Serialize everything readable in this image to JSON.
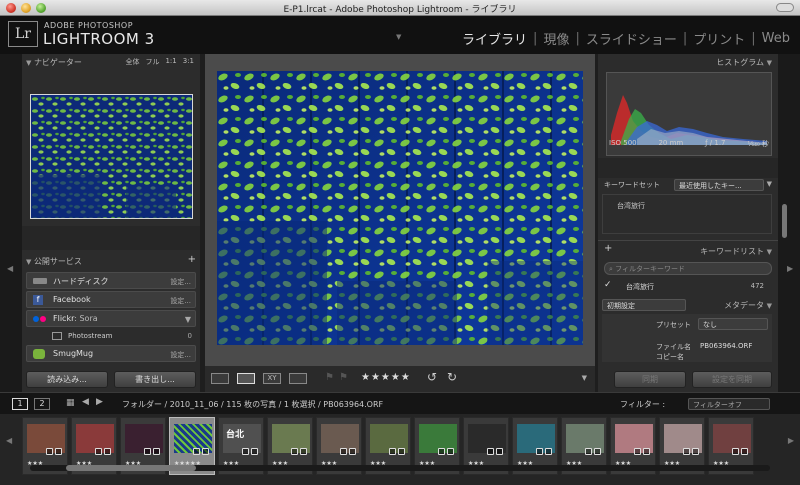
{
  "window": {
    "title": "E-P1.lrcat - Adobe Photoshop Lightroom - ライブラリ"
  },
  "brand": {
    "small": "ADOBE PHOTOSHOP",
    "big": "LIGHTROOM 3",
    "logo": "Lr"
  },
  "modules": [
    {
      "label": "ライブラリ",
      "active": true
    },
    {
      "label": "現像",
      "active": false
    },
    {
      "label": "スライドショー",
      "active": false
    },
    {
      "label": "プリント",
      "active": false
    },
    {
      "label": "Web",
      "active": false
    }
  ],
  "left": {
    "navigator": {
      "title": "ナビゲーター",
      "options": [
        "全体",
        "フル",
        "1:1",
        "3:1"
      ]
    },
    "publish": {
      "title": "公開サービス",
      "services": [
        {
          "label": "ハードディスク",
          "setting": "設定..."
        },
        {
          "label": "Facebook",
          "setting": "設定..."
        },
        {
          "label": "Flickr",
          "account": ": Sora"
        },
        {
          "label": "Photostream",
          "count": "0"
        },
        {
          "label": "SmugMug",
          "setting": "設定..."
        }
      ]
    },
    "import_button": "読み込み...",
    "export_button": "書き出し..."
  },
  "right": {
    "histogram": {
      "title": "ヒストグラム",
      "iso": "ISO 500",
      "focal": "20 mm",
      "aperture": "ƒ / 1.7",
      "shutter": "¹⁄₆₄₀ 秒"
    },
    "keyword_set": {
      "label": "キーワードセット",
      "value": "最近使用したキー...",
      "chip": "台湾旅行"
    },
    "keyword_list": {
      "title": "キーワードリスト",
      "filter_placeholder": "フィルターキーワード",
      "items": [
        {
          "name": "台湾旅行",
          "count": "472",
          "checked": true
        }
      ]
    },
    "metadata": {
      "title": "メタデータ",
      "preset_default": "初期設定",
      "preset_label": "プリセット",
      "preset_value": "なし",
      "file_label": "ファイル名",
      "file_value": "PB063964.ORF",
      "copy_label": "コピー名"
    },
    "sync_button": "同期",
    "sync_settings_button": "設定を同期"
  },
  "toolbar": {
    "stars": "★★★★★"
  },
  "filmstrip": {
    "screens": [
      "1",
      "2"
    ],
    "path": "フォルダー / 2010_11_06 / 115 枚の写真 / 1 枚選択 / PB063964.ORF",
    "filter_label": "フィルター :",
    "filter_value": "フィルターオフ",
    "thumbs": [
      {
        "stars": "★★★",
        "color": "#7a4a3a"
      },
      {
        "stars": "★★★",
        "color": "#8a3a3a"
      },
      {
        "stars": "★★★",
        "color": "#3a2030"
      },
      {
        "stars": "★★★★★",
        "color": "#2a3a70",
        "selected": true
      },
      {
        "stars": "★★★",
        "color": "#505050",
        "label": "台北"
      },
      {
        "stars": "★★★",
        "color": "#6a7a50"
      },
      {
        "stars": "★★★",
        "color": "#6a5a50"
      },
      {
        "stars": "★★★",
        "color": "#5a6a40"
      },
      {
        "stars": "★★★",
        "color": "#3a7a3a"
      },
      {
        "stars": "★★★",
        "color": "#2a2a2a"
      },
      {
        "stars": "★★★",
        "color": "#2a6a7a"
      },
      {
        "stars": "★★★",
        "color": "#6a7a6a"
      },
      {
        "stars": "★★★",
        "color": "#b07a80"
      },
      {
        "stars": "★★★",
        "color": "#a08a8a"
      },
      {
        "stars": "★★★",
        "color": "#704040"
      },
      {
        "stars": "★★★",
        "color": "#6a5a3a"
      }
    ]
  }
}
